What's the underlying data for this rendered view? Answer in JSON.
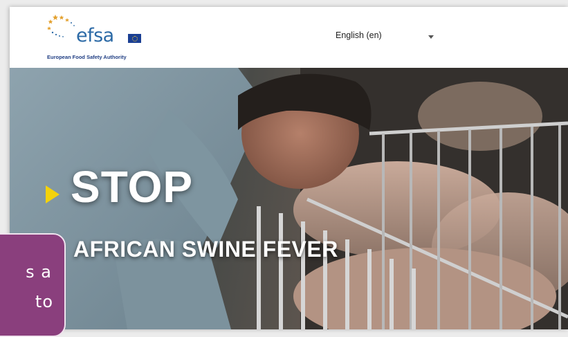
{
  "header": {
    "logo": {
      "wordmark": "efsa",
      "subtitle": "European Food Safety Authority"
    },
    "language_selector": {
      "label": "English (en)",
      "icon": "caret-down-icon"
    }
  },
  "hero": {
    "headline": "STOP",
    "subheadline": "AFRICAN SWINE FEVER",
    "arrow_color": "#f4d20a",
    "image_subject": "farmer-and-pigs-photo"
  },
  "tooltip": {
    "line1": "s a",
    "line2": "to",
    "background": "#8a3f7d"
  },
  "colors": {
    "brand_blue": "#2c6aa6",
    "logo_star_orange": "#e3a12f"
  }
}
